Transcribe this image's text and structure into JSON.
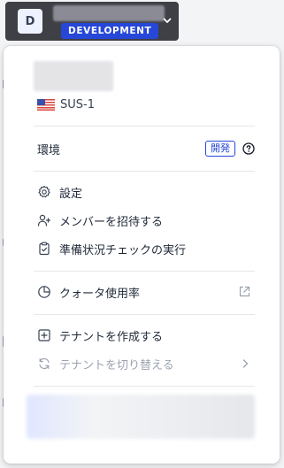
{
  "header": {
    "avatar_letter": "D",
    "env_badge": "DEVELOPMENT"
  },
  "region": {
    "flag": "us-flag-icon",
    "label": "SUS-1"
  },
  "environment": {
    "label": "環境",
    "tag": "開発"
  },
  "menu": {
    "settings": "設定",
    "invite": "メンバーを招待する",
    "readiness": "準備状況チェックの実行",
    "quota": "クォータ使用率",
    "create_tenant": "テナントを作成する",
    "switch_tenant": "テナントを切り替える"
  },
  "colors": {
    "accent": "#2747d8",
    "header_bg": "#3f3f46"
  }
}
